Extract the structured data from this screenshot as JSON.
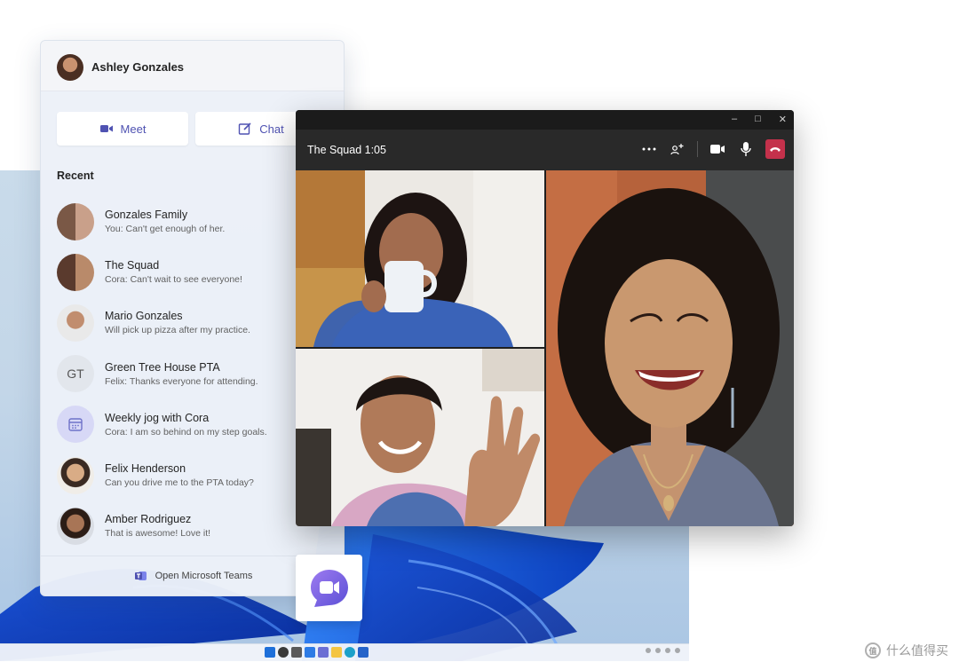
{
  "flyout": {
    "user_name": "Ashley Gonzales",
    "meet_label": "Meet",
    "chat_label": "Chat",
    "recent_label": "Recent",
    "footer_label": "Open Microsoft Teams",
    "conversations": [
      {
        "title": "Gonzales Family",
        "preview": "You: Can't get enough of her."
      },
      {
        "title": "The Squad",
        "preview": "Cora: Can't wait to see everyone!"
      },
      {
        "title": "Mario Gonzales",
        "preview": "Will pick up pizza after my practice."
      },
      {
        "title": "Green Tree House PTA",
        "preview": "Felix: Thanks everyone for attending.",
        "initials": "GT"
      },
      {
        "title": "Weekly jog with Cora",
        "preview": "Cora: I am so behind on my step goals."
      },
      {
        "title": "Felix Henderson",
        "preview": "Can you drive me to the PTA today?"
      },
      {
        "title": "Amber Rodriguez",
        "preview": "That is awesome! Love it!"
      }
    ]
  },
  "call": {
    "title": "The Squad 1:05",
    "controls": [
      "more-icon",
      "people-add-icon",
      "camera-icon",
      "mic-icon",
      "hangup-icon"
    ]
  },
  "colors": {
    "accent": "#4f52b2",
    "hangup": "#c4314b"
  },
  "watermark": {
    "logo": "值",
    "text": "什么值得买"
  }
}
